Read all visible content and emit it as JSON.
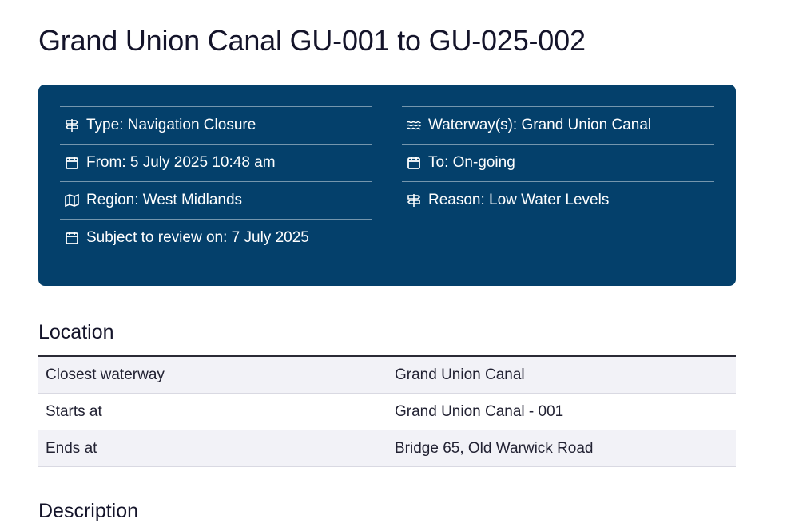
{
  "page": {
    "title": "Grand Union Canal GU-001 to GU-025-002"
  },
  "info": {
    "left": [
      {
        "icon": "signpost-icon",
        "text": "Type: Navigation Closure"
      },
      {
        "icon": "calendar-icon",
        "text": "From: 5 July 2025 10:48 am"
      },
      {
        "icon": "map-icon",
        "text": "Region: West Midlands"
      },
      {
        "icon": "calendar-icon",
        "text": "Subject to review on: 7 July 2025"
      }
    ],
    "right": [
      {
        "icon": "waves-icon",
        "text": "Waterway(s): Grand Union Canal"
      },
      {
        "icon": "calendar-icon",
        "text": "To: On-going"
      },
      {
        "icon": "signpost-icon",
        "text": "Reason: Low Water Levels"
      }
    ]
  },
  "location": {
    "heading": "Location",
    "rows": [
      {
        "label": "Closest waterway",
        "value": "Grand Union Canal"
      },
      {
        "label": "Starts at",
        "value": "Grand Union Canal - 001"
      },
      {
        "label": "Ends at",
        "value": "Bridge 65, Old Warwick Road"
      }
    ]
  },
  "description": {
    "heading": "Description"
  },
  "colors": {
    "panel": "#04406b",
    "row_stripe": "#f2f2f7"
  }
}
